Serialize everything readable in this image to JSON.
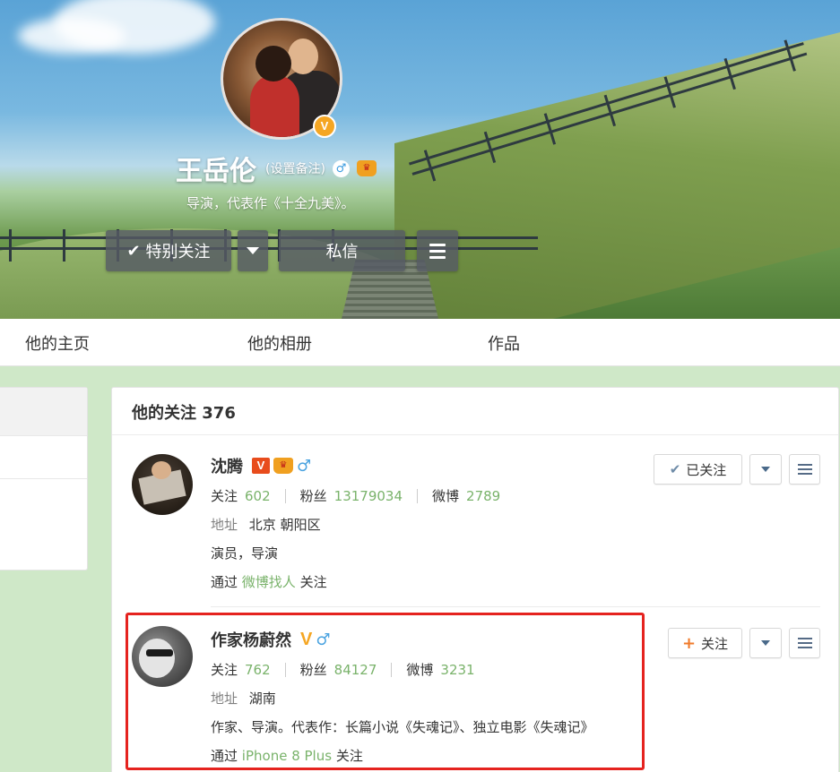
{
  "profile": {
    "name": "王岳伦",
    "remark": "(设置备注)",
    "gender_icon": "male-icon",
    "intro": "导演，代表作《十全九美》。",
    "verified_badge": "V"
  },
  "actions": {
    "special_follow": "特别关注",
    "message": "私信"
  },
  "tabs": [
    {
      "label": "他的主页"
    },
    {
      "label": "他的相册"
    },
    {
      "label": "作品"
    }
  ],
  "follow_list": {
    "title": "他的关注 376",
    "items": [
      {
        "name": "沈腾",
        "badge": "V",
        "badge_type": "red-v",
        "following_label": "关注",
        "following": "602",
        "fans_label": "粉丝",
        "fans": "13179034",
        "weibo_label": "微博",
        "weibo": "2789",
        "address_label": "地址",
        "address": "北京 朝阳区",
        "description": "演员，导演",
        "via_prefix": "通过",
        "via": "微博找人",
        "via_suffix": "关注",
        "follow_button": "已关注"
      },
      {
        "name": "作家杨蔚然",
        "badge": "V",
        "badge_type": "gold-v",
        "following_label": "关注",
        "following": "762",
        "fans_label": "粉丝",
        "fans": "84127",
        "weibo_label": "微博",
        "weibo": "3231",
        "address_label": "地址",
        "address": "湖南",
        "description": "作家、导演。代表作：长篇小说《失魂记》、独立电影《失魂记》",
        "via_prefix": "通过",
        "via": "iPhone 8 Plus",
        "via_suffix": "关注",
        "follow_button": "关注"
      }
    ]
  },
  "colors": {
    "accent_green": "#7ab36b",
    "highlight_red": "#e5231f",
    "plus_orange": "#f07a2a",
    "v_gold": "#f5a623",
    "v_red": "#e84c1c"
  }
}
